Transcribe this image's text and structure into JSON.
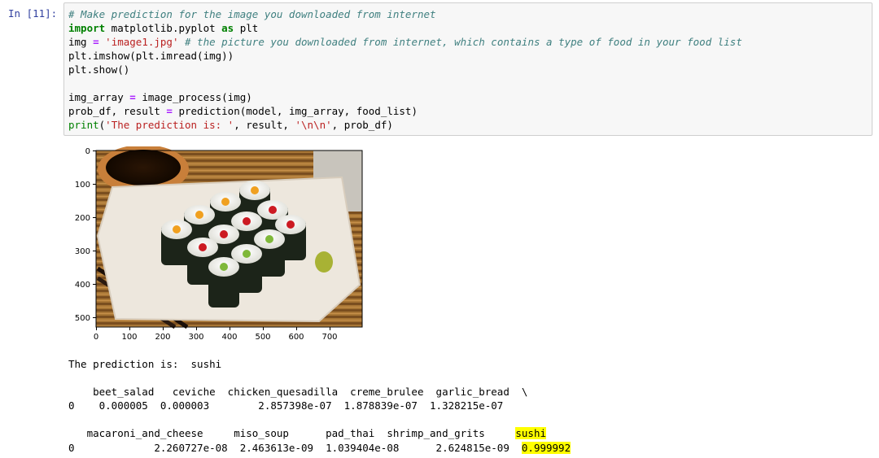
{
  "cell": {
    "prompt": "In [11]:"
  },
  "code": {
    "l1": "# Make prediction for the image you downloaded from internet",
    "l2_kw": "import",
    "l2_mod": " matplotlib.pyplot ",
    "l2_as": "as",
    "l2_alias": " plt",
    "l3_var": "img ",
    "l3_eq": "=",
    "l3_str": " 'image1.jpg'",
    "l3_cm": " # the picture you downloaded from internet, which contains a type of food in your food list",
    "l4": "plt.imshow(plt.imread(img))",
    "l5": "plt.show()",
    "l7_var": "img_array ",
    "l7_eq": "=",
    "l7_rest": " image_process(img)",
    "l8_var": "prob_df, result ",
    "l8_eq": "=",
    "l8_rest": " prediction(model, img_array, food_list)",
    "l9_fn": "print",
    "l9_p1": "(",
    "l9_s1": "'The prediction is: '",
    "l9_p2": ", result, ",
    "l9_s2": "'\\n\\n'",
    "l9_p3": ", prob_df)"
  },
  "plot": {
    "yticks": [
      "0",
      "100",
      "200",
      "300",
      "400",
      "500"
    ],
    "xticks": [
      "0",
      "100",
      "200",
      "300",
      "400",
      "500",
      "600",
      "700"
    ]
  },
  "output": {
    "prediction_line": "The prediction is:  sushi",
    "table1": {
      "header": "    beet_salad   ceviche  chicken_quesadilla  creme_brulee  garlic_bread  \\",
      "row": "0    0.000005  0.000003        2.857398e-07  1.878839e-07  1.328215e-07"
    },
    "table2": {
      "header_main": "   macaroni_and_cheese     miso_soup      pad_thai  shrimp_and_grits     ",
      "header_hl": "sushi",
      "row_main": "0             2.260727e-08  2.463613e-09  1.039404e-08      2.624815e-09  ",
      "row_hl": "0.999992"
    }
  },
  "colors": {
    "prompt": "#303f9f",
    "highlight": "#ffff00"
  }
}
